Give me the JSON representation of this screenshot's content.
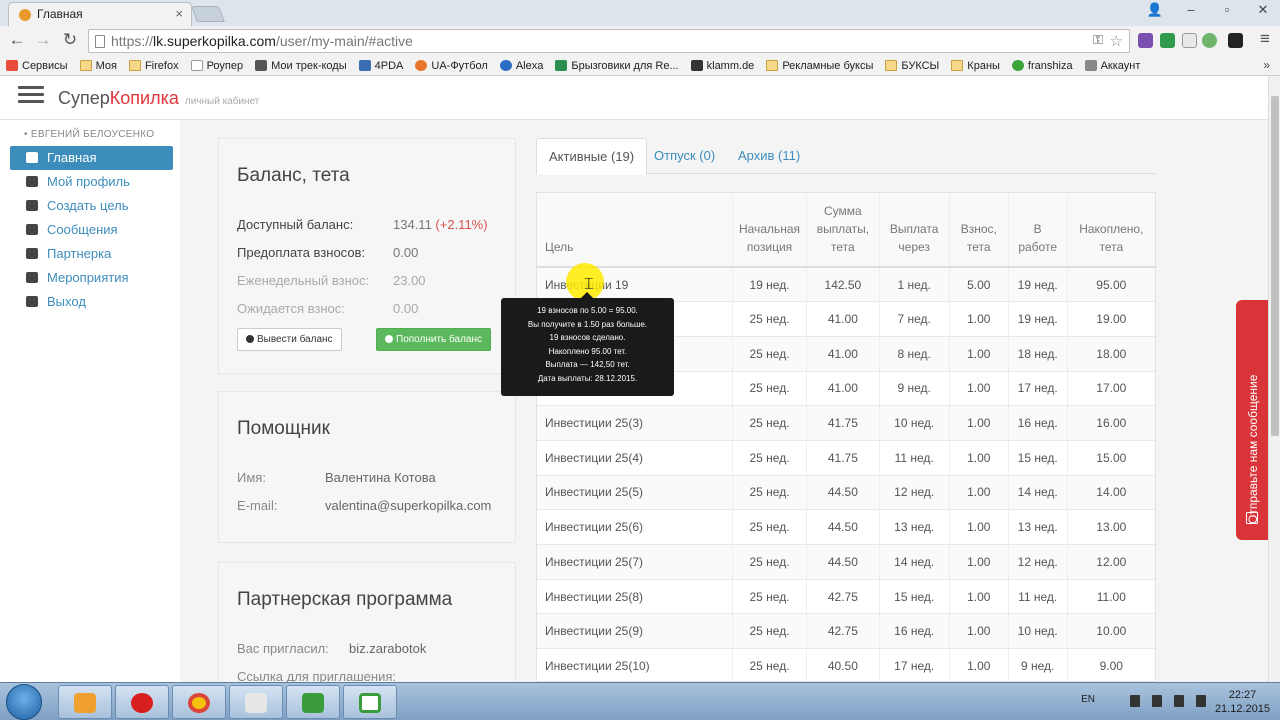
{
  "browser": {
    "tab_title": "Главная",
    "url_prefix": "https://",
    "url_host": "lk.superkopilka.com",
    "url_path": "/user/my-main/#active",
    "bookmarks": [
      "Сервисы",
      "Моя",
      "Firefox",
      "Роупер",
      "Мои трек-коды",
      "4PDA",
      "UA-Футбол",
      "Alexa",
      "Брызговики для Re...",
      "klamm.de",
      "Рекламные буксы",
      "БУКСЫ",
      "Краны",
      "franshiza",
      "Аккаунт"
    ],
    "bookmarks_more": "»"
  },
  "app": {
    "brand_part1": "Супер",
    "brand_part2": "Копилка",
    "brand_sub": "личный кабинет"
  },
  "sidebar": {
    "user": "• ЕВГЕНИЙ БЕЛОУСЕНКО",
    "items": [
      {
        "label": "Главная",
        "icon": "dashboard-icon",
        "active": true
      },
      {
        "label": "Мой профиль",
        "icon": "user-icon"
      },
      {
        "label": "Создать цель",
        "icon": "target-icon"
      },
      {
        "label": "Сообщения",
        "icon": "envelope-icon"
      },
      {
        "label": "Партнерка",
        "icon": "partners-icon"
      },
      {
        "label": "Мероприятия",
        "icon": "events-icon"
      },
      {
        "label": "Выход",
        "icon": "logout-icon"
      }
    ]
  },
  "balance": {
    "title": "Баланс, тета",
    "available_label": "Доступный баланс:",
    "available_value": "134.11",
    "available_change": "(+2.11%)",
    "prepay_label": "Предоплата взносов:",
    "prepay_value": "0.00",
    "weekly_label": "Еженедельный взнос:",
    "weekly_value": "23.00",
    "expected_label": "Ожидается взнос:",
    "expected_value": "0.00",
    "withdraw_label": "Вывести баланс",
    "topup_label": "Пополнить баланс"
  },
  "helper": {
    "title": "Помощник",
    "name_label": "Имя:",
    "name_value": "Валентина Котова",
    "email_label": "E-mail:",
    "email_value": "valentina@superkopilka.com"
  },
  "partner": {
    "title": "Партнерская программа",
    "invited_label": "Вас пригласил:",
    "invited_value": "biz.zarabotok",
    "link_label": "Ссылка для приглашения:"
  },
  "tabs": [
    "Активные (19)",
    "Отпуск (0)",
    "Архив (11)"
  ],
  "table": {
    "headers": [
      [
        "Цель"
      ],
      [
        "Начальная",
        "позиция"
      ],
      [
        "Сумма",
        "выплаты,",
        "тета"
      ],
      [
        "Выплата",
        "через"
      ],
      [
        "Взнос,",
        "тета"
      ],
      [
        "В",
        "работе"
      ],
      [
        "Накоплено,",
        "тета"
      ]
    ],
    "rows": [
      [
        "Инвестиции 19",
        "19 нед.",
        "142.50",
        "1 нед.",
        "5.00",
        "19 нед.",
        "95.00"
      ],
      [
        "",
        "25 нед.",
        "41.00",
        "7 нед.",
        "1.00",
        "19 нед.",
        "19.00"
      ],
      [
        "",
        "25 нед.",
        "41.00",
        "8 нед.",
        "1.00",
        "18 нед.",
        "18.00"
      ],
      [
        "",
        "25 нед.",
        "41.00",
        "9 нед.",
        "1.00",
        "17 нед.",
        "17.00"
      ],
      [
        "Инвестиции 25(3)",
        "25 нед.",
        "41.75",
        "10 нед.",
        "1.00",
        "16 нед.",
        "16.00"
      ],
      [
        "Инвестиции 25(4)",
        "25 нед.",
        "41.75",
        "11 нед.",
        "1.00",
        "15 нед.",
        "15.00"
      ],
      [
        "Инвестиции 25(5)",
        "25 нед.",
        "44.50",
        "12 нед.",
        "1.00",
        "14 нед.",
        "14.00"
      ],
      [
        "Инвестиции 25(6)",
        "25 нед.",
        "44.50",
        "13 нед.",
        "1.00",
        "13 нед.",
        "13.00"
      ],
      [
        "Инвестиции 25(7)",
        "25 нед.",
        "44.50",
        "14 нед.",
        "1.00",
        "12 нед.",
        "12.00"
      ],
      [
        "Инвестиции 25(8)",
        "25 нед.",
        "42.75",
        "15 нед.",
        "1.00",
        "11 нед.",
        "11.00"
      ],
      [
        "Инвестиции 25(9)",
        "25 нед.",
        "42.75",
        "16 нед.",
        "1.00",
        "10 нед.",
        "10.00"
      ],
      [
        "Инвестиции 25(10)",
        "25 нед.",
        "40.50",
        "17 нед.",
        "1.00",
        "9 нед.",
        "9.00"
      ]
    ]
  },
  "tooltip": [
    "19 взносов по 5.00 = 95.00.",
    "Вы получите в 1.50 раз больше.",
    "19 взносов сделано.",
    "Накоплено 95.00 тет.",
    "Выплата — 142,50 тет.",
    "Дата выплаты: 28.12.2015."
  ],
  "feedback_label": "Отправьте нам сообщение",
  "taskbar": {
    "lang": "EN",
    "time": "22:27",
    "date": "21.12.2015"
  },
  "colors": {
    "primary": "#3c8dbc",
    "success": "#5cb85c",
    "brand_red": "#e1343b",
    "feedback": "#d9343a"
  }
}
